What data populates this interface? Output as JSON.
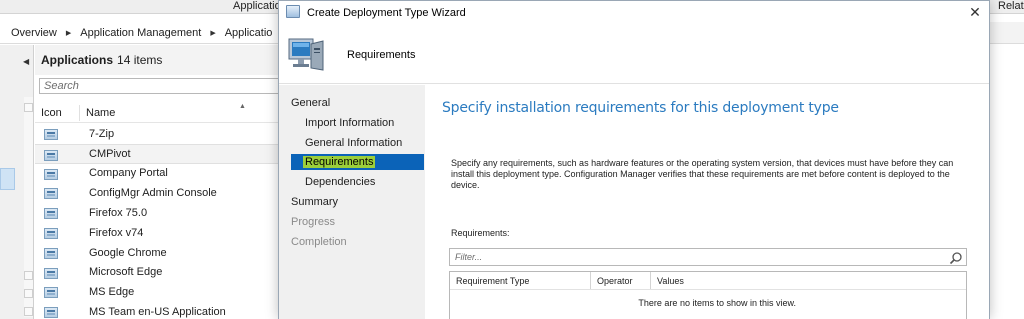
{
  "console": {
    "top_tab_left": "Applicatio",
    "top_tab_right": "Relat",
    "breadcrumb": [
      "Overview",
      "Application Management",
      "Applicatio"
    ]
  },
  "app_list": {
    "title": "Applications",
    "count": "14 items",
    "search_placeholder": "Search",
    "col_icon": "Icon",
    "col_name": "Name",
    "selected_index": 1,
    "items": [
      "7-Zip",
      "CMPivot",
      "Company Portal",
      "ConfigMgr Admin Console",
      "Firefox 75.0",
      "Firefox v74",
      "Google Chrome",
      "Microsoft Edge",
      "MS Edge",
      "MS Team en-US Application"
    ]
  },
  "wizard": {
    "title": "Create Deployment Type Wizard",
    "banner_heading": "Requirements",
    "nav": {
      "general": "General",
      "import_information": "Import Information",
      "general_information": "General Information",
      "requirements": "Requirements",
      "dependencies": "Dependencies",
      "summary": "Summary",
      "progress": "Progress",
      "completion": "Completion"
    },
    "page_title": "Specify installation requirements for this deployment type",
    "description": "Specify any requirements, such as hardware features or the operating system version, that devices must have before they can install this deployment type. Configuration Manager verifies that these requirements are met before content is deployed to the device.",
    "requirements_label": "Requirements:",
    "filter_placeholder": "Filter...",
    "table_headers": {
      "requirement_type": "Requirement Type",
      "operator": "Operator",
      "values": "Values"
    },
    "empty_message": "There are no items to show in this view."
  },
  "colors": {
    "accent_blue": "#2b7bc0",
    "nav_selected_bg": "#0b63b8",
    "nav_selected_highlight": "#9ccf3a"
  }
}
